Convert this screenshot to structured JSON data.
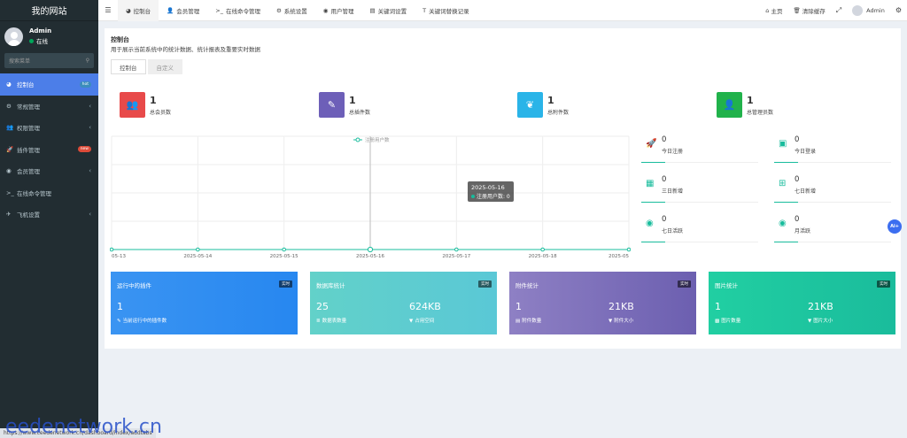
{
  "sidebar": {
    "brand": "我的网站",
    "user": {
      "name": "Admin",
      "status": "在线"
    },
    "search_placeholder": "搜索菜单",
    "items": [
      {
        "label": "控制台",
        "icon": "dashboard-icon",
        "badge": "hot",
        "active": true
      },
      {
        "label": "常规管理",
        "icon": "cogs-icon",
        "arrow": "‹"
      },
      {
        "label": "权限管理",
        "icon": "group-icon",
        "arrow": "‹"
      },
      {
        "label": "插件管理",
        "icon": "rocket-icon",
        "badge": "new"
      },
      {
        "label": "会员管理",
        "icon": "user-circle-icon",
        "arrow": "‹"
      },
      {
        "label": "在线命令管理",
        "icon": "terminal-icon"
      },
      {
        "label": "飞机设置",
        "icon": "plane-icon",
        "arrow": "‹"
      }
    ]
  },
  "topnav": {
    "tabs": [
      {
        "label": "控制台",
        "icon": "dashboard-icon"
      },
      {
        "label": "会员管理",
        "icon": "user-icon"
      },
      {
        "label": "在线命令管理",
        "icon": "terminal-icon"
      },
      {
        "label": "系统设置",
        "icon": "gear-icon"
      },
      {
        "label": "用户管理",
        "icon": "user-circle-icon"
      },
      {
        "label": "关键词设置",
        "icon": "file-icon"
      },
      {
        "label": "关键词替换记录",
        "icon": "text-icon"
      }
    ],
    "right": {
      "home": "主页",
      "clear_cache": "清除缓存",
      "user": "Admin"
    }
  },
  "page": {
    "title": "控制台",
    "description": "用于展示当前系统中的统计数据、统计报表及重要实时数据",
    "tabs": [
      "控制台",
      "自定义"
    ]
  },
  "stats": [
    {
      "value": "1",
      "label": "总会员数",
      "color": "#e84a4a",
      "icon": "users-icon"
    },
    {
      "value": "1",
      "label": "总插件数",
      "color": "#6d5fb8",
      "icon": "magic-wand-icon"
    },
    {
      "value": "1",
      "label": "总附件数",
      "color": "#2ab4e8",
      "icon": "leaf-icon"
    },
    {
      "value": "1",
      "label": "总管理员数",
      "color": "#21b24b",
      "icon": "user-icon"
    }
  ],
  "chart_data": {
    "type": "line",
    "categories": [
      "2025-05-13",
      "2025-05-14",
      "2025-05-15",
      "2025-05-16",
      "2025-05-17",
      "2025-05-18",
      "2025-05-19"
    ],
    "tick_labels": [
      "05-13",
      "2025-05-14",
      "2025-05-15",
      "2025-05-16",
      "2025-05-17",
      "2025-05-18",
      "2025-05"
    ],
    "series": [
      {
        "name": "注册用户数",
        "values": [
          0,
          0,
          0,
          0,
          0,
          0,
          0
        ]
      }
    ],
    "legend": "top-center",
    "grid": true,
    "color": "#18bc9c",
    "tooltip": {
      "title": "2025-05-16",
      "text": "注册用户数: 0"
    }
  },
  "mini_stats": [
    {
      "value": "0",
      "label": "今日注册",
      "icon": "rocket-icon"
    },
    {
      "value": "0",
      "label": "今日登录",
      "icon": "vcard-icon"
    },
    {
      "value": "0",
      "label": "三日新增",
      "icon": "calendar-icon"
    },
    {
      "value": "0",
      "label": "七日新增",
      "icon": "calendar-plus-icon"
    },
    {
      "value": "0",
      "label": "七日活跃",
      "icon": "user-circle-icon"
    },
    {
      "value": "0",
      "label": "月活跃",
      "icon": "user-circle-icon"
    }
  ],
  "cards": [
    {
      "title": "运行中的插件",
      "badge": "实时",
      "items": [
        {
          "value": "1",
          "label": "当前运行中的插件数",
          "icon": "magic-wand-icon"
        }
      ]
    },
    {
      "title": "数据库统计",
      "badge": "实时",
      "items": [
        {
          "value": "25",
          "label": "数据表数量",
          "icon": "database-icon"
        },
        {
          "value": "624KB",
          "label": "占用空间",
          "icon": "filter-icon"
        }
      ]
    },
    {
      "title": "附件统计",
      "badge": "实时",
      "items": [
        {
          "value": "1",
          "label": "附件数量",
          "icon": "file-icon"
        },
        {
          "value": "21KB",
          "label": "附件大小",
          "icon": "filter-icon"
        }
      ]
    },
    {
      "title": "图片统计",
      "badge": "实时",
      "items": [
        {
          "value": "1",
          "label": "图片数量",
          "icon": "image-icon"
        },
        {
          "value": "21KB",
          "label": "图片大小",
          "icon": "filter-icon"
        }
      ]
    }
  ],
  "ai_button": "Ai+",
  "status_url": "https://www.ceedenetwork.cn/dashboard/index/addtabs",
  "watermark": "eedenetwork.cn"
}
